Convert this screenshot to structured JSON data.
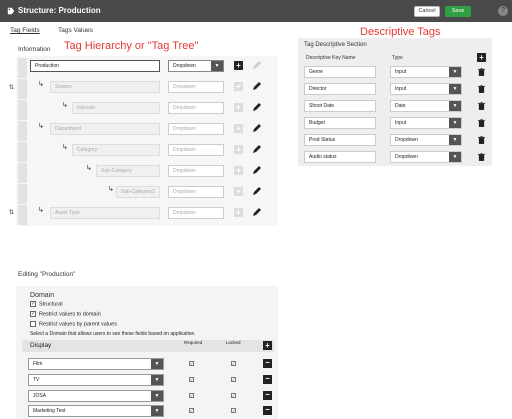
{
  "titlebar": {
    "title": "Structure: Production",
    "cancel_label": "Cancel",
    "save_label": "Save",
    "help_label": "?"
  },
  "tabs": [
    {
      "label": "Tag Fields",
      "active": true
    },
    {
      "label": "Tags Values",
      "active": false
    }
  ],
  "annotations": {
    "tree": "Tag Hierarchy or \"Tag Tree\"",
    "descriptive": "Descriptive Tags"
  },
  "information": {
    "title": "Information",
    "tree": [
      {
        "name": "Production",
        "type": "Dropdown",
        "level": 0,
        "active": true
      },
      {
        "name": "Season",
        "type": "Dropdown",
        "level": 1,
        "active": false
      },
      {
        "name": "Episode",
        "type": "Dropdown",
        "level": 2,
        "active": false
      },
      {
        "name": "Department",
        "type": "Dropdown",
        "level": 1,
        "active": false
      },
      {
        "name": "Category",
        "type": "Dropdown",
        "level": 2,
        "active": false
      },
      {
        "name": "Sub-Category",
        "type": "Dropdown",
        "level": 3,
        "active": false
      },
      {
        "name": "Sub-Category2",
        "type": "Dropdown",
        "level": 4,
        "active": false
      },
      {
        "name": "Asset Type",
        "type": "Dropdown",
        "level": 1,
        "active": false
      }
    ]
  },
  "descriptive": {
    "title": "Tag Descriptive Section",
    "col_key": "Descriptive Key Name",
    "col_type": "Type",
    "rows": [
      {
        "key": "Genre",
        "type": "Input"
      },
      {
        "key": "Director",
        "type": "Input"
      },
      {
        "key": "Shoot Date",
        "type": "Date"
      },
      {
        "key": "Budget",
        "type": "Input"
      },
      {
        "key": "Prod Status",
        "type": "Dropdown"
      },
      {
        "key": "Audio status",
        "type": "Dropdown"
      }
    ]
  },
  "editing": {
    "title": "Editing \"Production\"",
    "domain_label": "Domain",
    "checks": [
      {
        "label": "Structural",
        "checked": true
      },
      {
        "label": "Restrict values to domain",
        "checked": true
      },
      {
        "label": "Restrict values by parent values",
        "checked": false
      }
    ],
    "instruction": "Select a Domain that allows users to see these fields based on application.",
    "display_label": "Display",
    "col_required": "Required",
    "col_locked": "Locked",
    "display_rows": [
      {
        "value": "Film",
        "required": true,
        "locked": true
      },
      {
        "value": "TV",
        "required": true,
        "locked": true
      },
      {
        "value": "JOSA",
        "required": true,
        "locked": true
      },
      {
        "value": "Marketing Test",
        "required": true,
        "locked": true
      }
    ]
  }
}
